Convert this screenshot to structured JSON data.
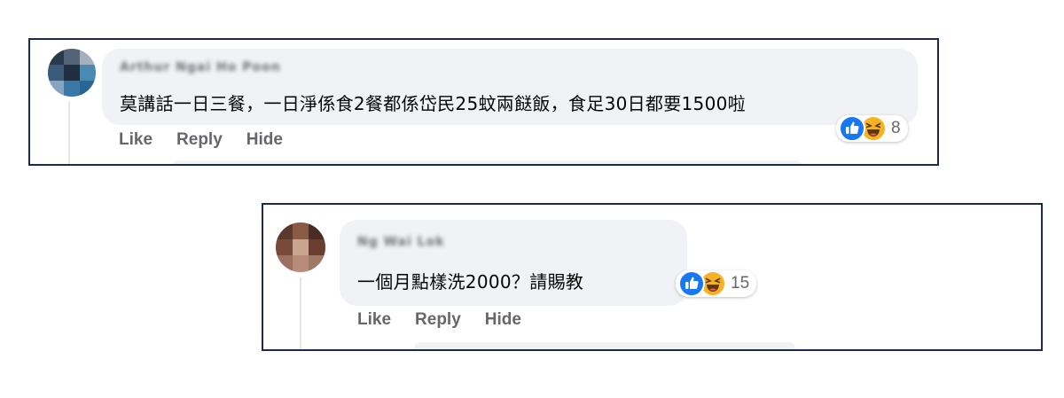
{
  "comments": [
    {
      "author": "Arthur Ngai Ho Poon",
      "text": "莫講話一日三餐，一日淨係食2餐都係岱民25蚊兩餸飯，食足30日都要1500啦",
      "actions": {
        "like": "Like",
        "reply": "Reply",
        "hide": "Hide"
      },
      "reactions": {
        "types": [
          "like",
          "haha"
        ],
        "count": "8"
      }
    },
    {
      "author": "Ng Wai Lok",
      "text": "一個月點樣洗2000？請賜教",
      "actions": {
        "like": "Like",
        "reply": "Reply",
        "hide": "Hide"
      },
      "reactions": {
        "types": [
          "like",
          "haha"
        ],
        "count": "15"
      }
    }
  ],
  "colors": {
    "frame_border": "#1c2b4a",
    "bubble": "#f0f2f5",
    "like_blue": "#1877f2",
    "haha_yellow": "#f7b125",
    "action_gray": "#65676b"
  },
  "icons": [
    "like-reaction-icon",
    "haha-reaction-icon"
  ]
}
